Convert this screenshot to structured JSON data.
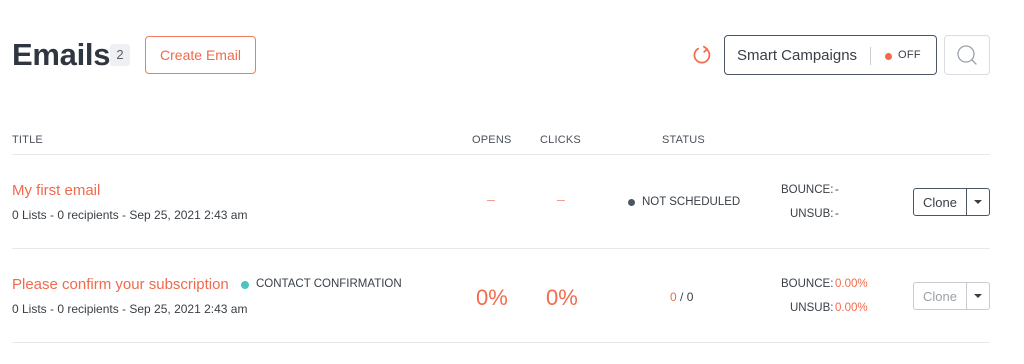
{
  "header": {
    "title": "Emails",
    "count": "2",
    "create_label": "Create Email",
    "smart_campaigns_label": "Smart Campaigns",
    "smart_campaigns_state": "OFF"
  },
  "columns": {
    "title": "TITLE",
    "opens": "OPENS",
    "clicks": "CLICKS",
    "status": "STATUS"
  },
  "emails": [
    {
      "title": "My first email",
      "meta": "0 Lists - 0 recipients - Sep 25, 2021 2:43 am",
      "opens": "–",
      "clicks": "–",
      "status": "NOT SCHEDULED",
      "bounce_label": "BOUNCE:",
      "bounce_value": "-",
      "unsub_label": "UNSUB:",
      "unsub_value": "-",
      "clone_label": "Clone"
    },
    {
      "title": "Please confirm your subscription",
      "tag": "CONTACT CONFIRMATION",
      "meta": "0 Lists - 0 recipients - Sep 25, 2021 2:43 am",
      "opens": "0%",
      "clicks": "0%",
      "sent": "0",
      "total": "0",
      "bounce_label": "BOUNCE:",
      "bounce_value": "0.00%",
      "unsub_label": "UNSUB:",
      "unsub_value": "0.00%",
      "clone_label": "Clone"
    }
  ],
  "colors": {
    "accent": "#f06a4c",
    "tag_dot": "#4fc1c0",
    "status_dot": "#4b5563"
  }
}
